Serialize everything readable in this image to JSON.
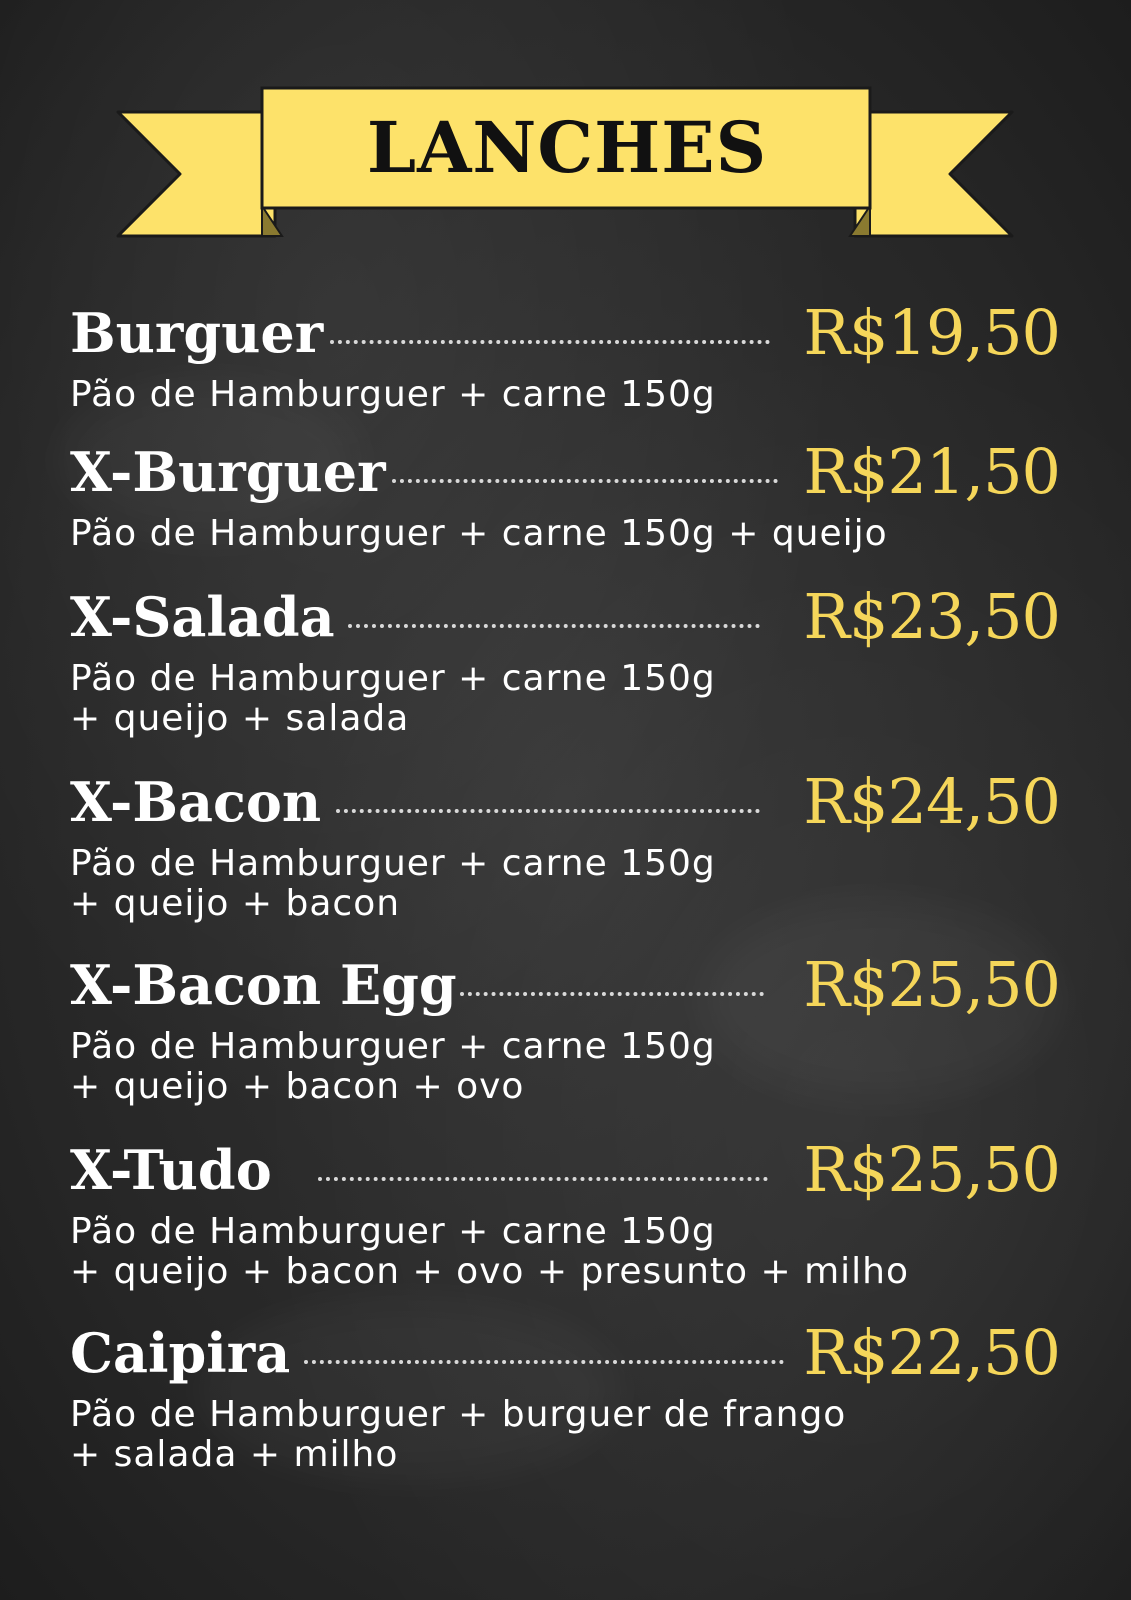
{
  "menu": {
    "title": "LANCHES",
    "colors": {
      "background": "#2b2b2b",
      "banner": "#fde26a",
      "price": "#f5d65a",
      "text": "#ffffff"
    },
    "items": [
      {
        "name": "Burguer",
        "price": "R$19,50",
        "description": [
          "Pão de Hamburguer + carne 150g"
        ]
      },
      {
        "name": "X-Burguer",
        "price": "R$21,50",
        "description": [
          "Pão de Hamburguer + carne 150g + queijo"
        ]
      },
      {
        "name": "X-Salada",
        "price": "R$23,50",
        "description": [
          "Pão de Hamburguer + carne 150g",
          "+ queijo + salada"
        ]
      },
      {
        "name": "X-Bacon",
        "price": "R$24,50",
        "description": [
          "Pão de Hamburguer + carne 150g",
          "+ queijo + bacon"
        ]
      },
      {
        "name": "X-Bacon Egg",
        "price": "R$25,50",
        "description": [
          "Pão de Hamburguer + carne 150g",
          "+ queijo + bacon + ovo"
        ]
      },
      {
        "name": "X-Tudo",
        "price": "R$25,50",
        "description": [
          "Pão de Hamburguer + carne 150g",
          "+ queijo + bacon + ovo + presunto + milho"
        ]
      },
      {
        "name": "Caipira",
        "price": "R$22,50",
        "description": [
          "Pão de Hamburguer + burguer de frango",
          "+ salada + milho"
        ]
      }
    ]
  }
}
